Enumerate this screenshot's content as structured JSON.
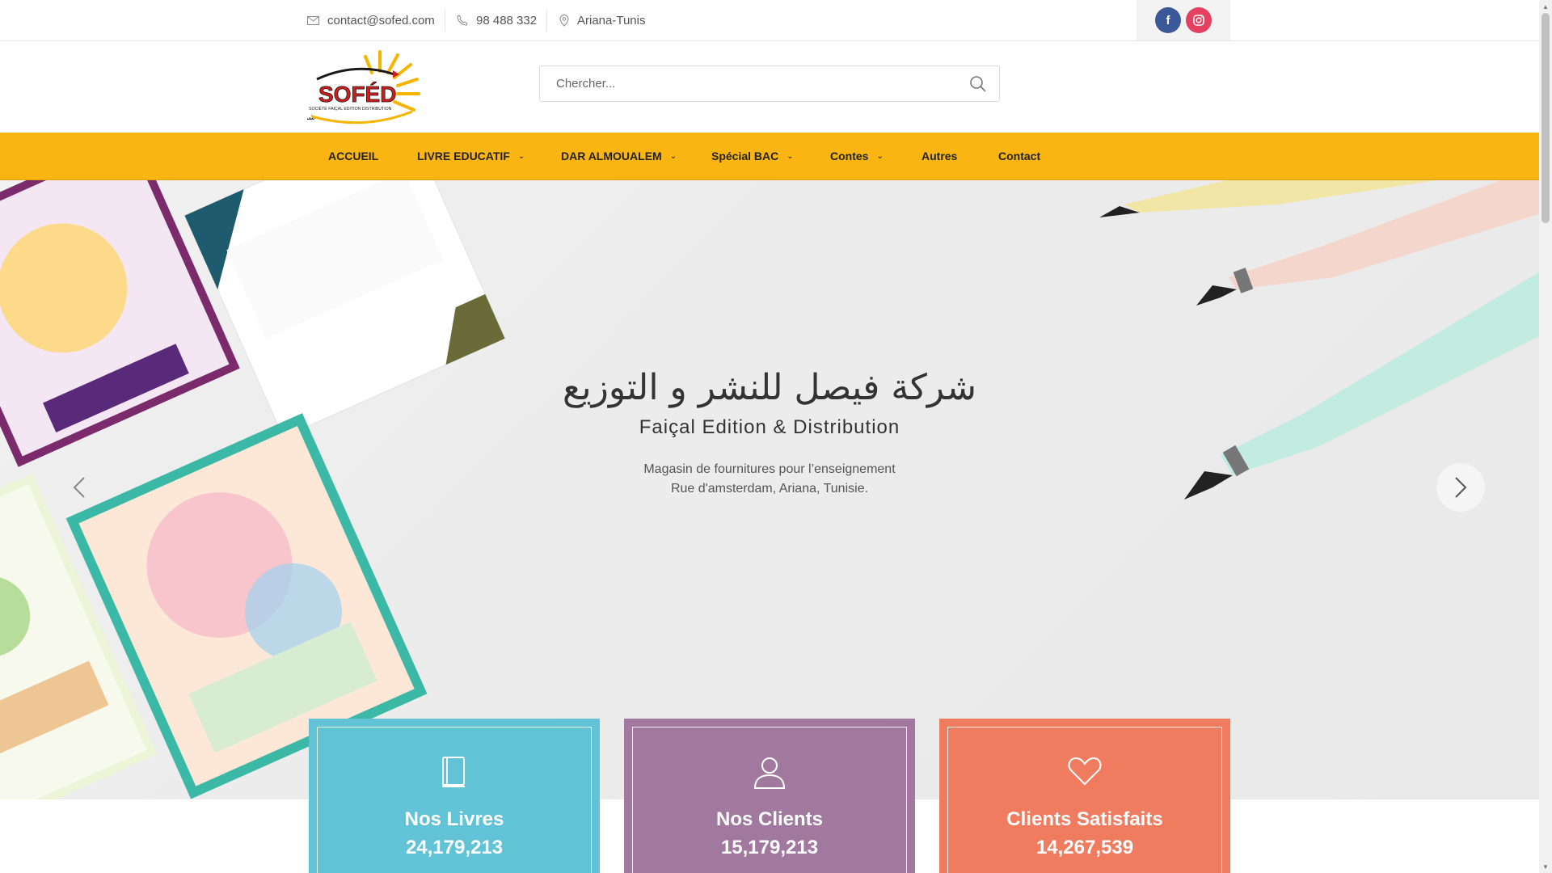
{
  "topbar": {
    "email": "contact@sofed.com",
    "phone": "98 488 332",
    "location": "Ariana-Tunis",
    "social": {
      "facebook_glyph": "f",
      "colors": {
        "facebook": "#3b5998",
        "instagram": "#e4405f"
      }
    }
  },
  "logo": {
    "text": "SOFÉD",
    "subtext": "SOCIÉTÉ FAIÇAL EDITION DISTRIBUTION",
    "arabic": "شركة فيصل للنشر و التوزيع"
  },
  "search": {
    "placeholder": "Chercher..."
  },
  "nav": {
    "accent": "#fbb512",
    "items": [
      {
        "label": "ACCUEIL",
        "dropdown": false
      },
      {
        "label": "LIVRE EDUCATIF",
        "dropdown": true
      },
      {
        "label": "DAR ALMOUALEM",
        "dropdown": true
      },
      {
        "label": "Spécial BAC",
        "dropdown": true
      },
      {
        "label": "Contes",
        "dropdown": true
      },
      {
        "label": "Autres",
        "dropdown": false
      },
      {
        "label": "Contact",
        "dropdown": false
      }
    ]
  },
  "hero": {
    "title_ar": "شركة فيصل للنشر و التوزيع",
    "title_fr": "Faiçal Edition & Distribution",
    "desc_line1": "Magasin de fournitures pour l’enseignement",
    "desc_line2": "Rue d'amsterdam, Ariana, Tunisie."
  },
  "stats": [
    {
      "label": "Nos Livres",
      "value": "24,179,213",
      "icon": "book-icon",
      "color": "#62c3d6"
    },
    {
      "label": "Nos Clients",
      "value": "15,179,213",
      "icon": "user-icon",
      "color": "#a1799f"
    },
    {
      "label": "Clients Satisfaits",
      "value": "14,267,539",
      "icon": "heart-icon",
      "color": "#f07c60"
    }
  ]
}
